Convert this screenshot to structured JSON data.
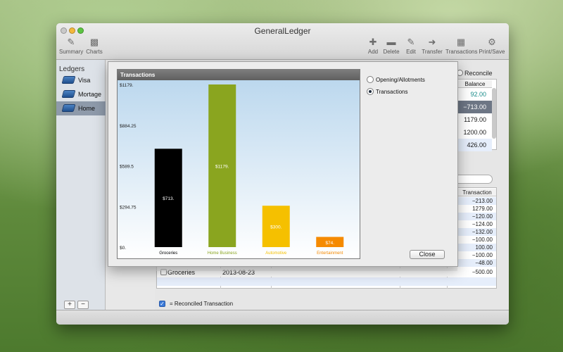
{
  "window": {
    "title": "GeneralLedger"
  },
  "toolbar": {
    "left": [
      {
        "label": "Summary",
        "icon": "summary-icon"
      },
      {
        "label": "Charts",
        "icon": "charts-icon"
      }
    ],
    "right": [
      {
        "label": "Add",
        "icon": "plus-icon"
      },
      {
        "label": "Delete",
        "icon": "minus-icon"
      },
      {
        "label": "Edit",
        "icon": "pencil-icon"
      },
      {
        "label": "Transfer",
        "icon": "arrow-right-icon"
      },
      {
        "label": "Transactions",
        "icon": "calculator-icon"
      },
      {
        "label": "Print/Save",
        "icon": "gear-icon"
      }
    ]
  },
  "sidebar": {
    "heading": "Ledgers",
    "items": [
      {
        "label": "Visa",
        "selected": false
      },
      {
        "label": "Mortage",
        "selected": false
      },
      {
        "label": "Home",
        "selected": true
      }
    ],
    "add_label": "+",
    "remove_label": "−"
  },
  "accounts": {
    "reconcile_label": "Reconcile",
    "balance_header": "Balance",
    "balances": [
      "92.00",
      "−713.00",
      "1179.00",
      "1200.00",
      "426.00"
    ]
  },
  "transactions": {
    "transaction_header": "Transaction",
    "amounts": [
      "−213.00",
      "1279.00",
      "−120.00",
      "−124.00",
      "−132.00",
      "−100.00",
      "100.00",
      "−100.00",
      "−48.00",
      "−500.00"
    ],
    "visible_row": {
      "category": "Groceries",
      "date": "2013-08-23",
      "amount": "−500.00"
    }
  },
  "footer": {
    "legend_text": "= Reconciled Transaction"
  },
  "popup": {
    "panel_title": "Transactions",
    "options": [
      {
        "label": "Opening/Allotments",
        "selected": false
      },
      {
        "label": "Transactions",
        "selected": true
      }
    ],
    "close_label": "Close"
  },
  "chart_data": {
    "type": "bar",
    "title": "Transactions",
    "categories": [
      "Groceries",
      "Home Business",
      "Automotive",
      "Entertainment"
    ],
    "values": [
      713,
      1179,
      300,
      74
    ],
    "value_labels": [
      "$713.",
      "$1179.",
      "$300.",
      "$74."
    ],
    "bar_colors": [
      "#000000",
      "#8aa51f",
      "#f5c000",
      "#f58a00"
    ],
    "category_label_colors": [
      "#000000",
      "#8aa51f",
      "#f5c000",
      "#f58a00"
    ],
    "y_ticks": [
      "$1179.",
      "$884.25",
      "$589.5",
      "$294.75",
      "$0."
    ],
    "ylim": [
      0,
      1179
    ],
    "grid": false,
    "background": "gradient-blue"
  }
}
